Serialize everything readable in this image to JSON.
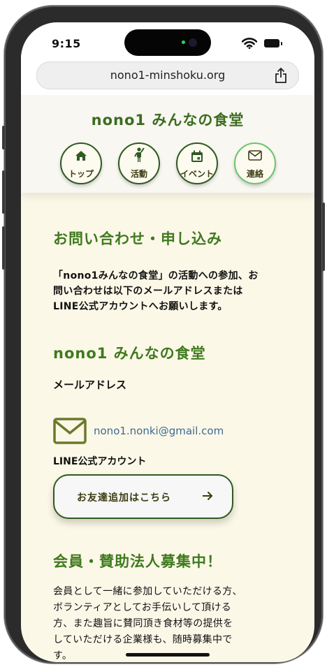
{
  "status": {
    "time": "9:15"
  },
  "browser": {
    "url": "nono1-minshoku.org"
  },
  "site": {
    "brand": "nono1 みんなの食堂",
    "nav": [
      {
        "label": "トップ",
        "icon": "home-icon"
      },
      {
        "label": "活動",
        "icon": "person-icon"
      },
      {
        "label": "イベント",
        "icon": "calendar-icon"
      },
      {
        "label": "連絡",
        "icon": "mail-icon"
      }
    ]
  },
  "contact": {
    "title": "お問い合わせ・申し込み",
    "intro_lines": [
      "「nono1みんなの食堂」の活動への参加、お",
      "問い合わせは以下のメールアドレスまたは",
      "LINE公式アカウントへお願いします。"
    ],
    "org_name": "nono1 みんなの食堂",
    "email_label": "メールアドレス",
    "email": "nono1.nonki@gmail.com",
    "line_label": "LINE公式アカウント",
    "line_button": "お友達追加はこちら"
  },
  "members": {
    "title": "会員・賛助法人募集中！",
    "body_lines": [
      "会員として一緒に参加していただける方、",
      "ボランティアとしてお手伝いして頂ける",
      "方、また趣旨に賛同頂き食材等の提供を",
      "していただける企業様も、随時募集中で",
      "す。"
    ]
  },
  "colors": {
    "accent": "#3f7a1e",
    "background": "#fcf8e8",
    "link": "#3d6a94"
  }
}
